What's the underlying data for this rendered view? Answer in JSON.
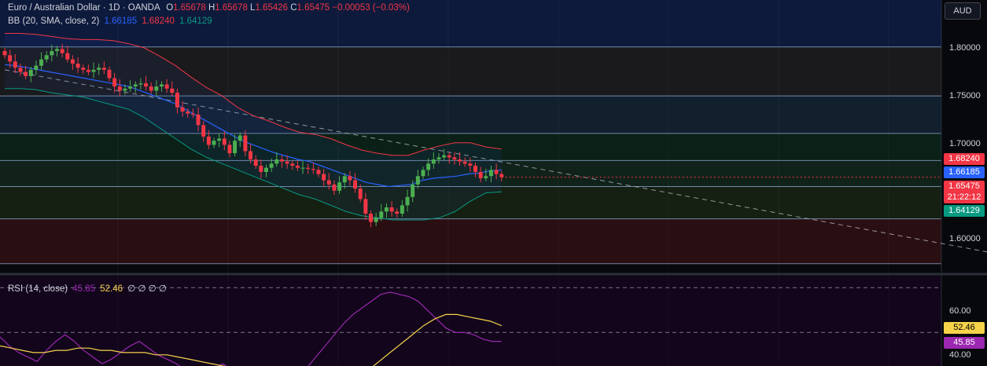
{
  "legend": {
    "symbol": "Euro / Australian Dollar · 1D · OANDA",
    "o_label": "O",
    "o_value": "1.65678",
    "h_label": "H",
    "h_value": "1.65678",
    "l_label": "L",
    "l_value": "1.65426",
    "c_label": "C",
    "c_value": "1.65475",
    "change": "−0.00053 (−0.03%)",
    "bb_label": "BB (20, SMA, close, 2)",
    "bb_basis": "1.66185",
    "bb_upper": "1.68240",
    "bb_lower": "1.64129",
    "rsi_label": "RSI (14, close)",
    "rsi_value": "45.85",
    "rsi_ma": "52.46",
    "rsi_extra": "∅ ∅ ∅ ∅"
  },
  "currency_button": "AUD",
  "price_axis": [
    "1.80000",
    "1.75000",
    "1.70000",
    "1.60000"
  ],
  "price_tags": {
    "upper": "1.68240",
    "basis": "1.66185",
    "close": "1.65475",
    "countdown": "21:22:12",
    "lower": "1.64129"
  },
  "rsi_axis": [
    "60.00",
    "40.00"
  ],
  "rsi_tags": {
    "ma": "52.46",
    "rsi": "45.85"
  },
  "colors": {
    "up": "#4caf50",
    "down": "#f23645",
    "upper_band": "#f23645",
    "basis": "#2962ff",
    "lower_band": "#089981",
    "rsi": "#9c27b0",
    "rsi_ma": "#f7d34a",
    "close_tag": "#f23645"
  },
  "chart_data": {
    "type": "candlestick",
    "title": "Euro / Australian Dollar · 1D · OANDA",
    "ylim": [
      1.565,
      1.825
    ],
    "horizontal_levels": [
      1.78,
      1.733,
      1.697,
      1.671,
      1.646,
      1.615,
      1.572
    ],
    "zones": [
      {
        "from": 1.78,
        "to": 1.825,
        "color": "#0e1a3c"
      },
      {
        "from": 1.733,
        "to": 1.78,
        "color": "#1a1a1d"
      },
      {
        "from": 1.697,
        "to": 1.733,
        "color": "#12202e"
      },
      {
        "from": 1.671,
        "to": 1.697,
        "color": "#0b2118"
      },
      {
        "from": 1.646,
        "to": 1.671,
        "color": "#10221a"
      },
      {
        "from": 1.615,
        "to": 1.646,
        "color": "#152012"
      },
      {
        "from": 1.572,
        "to": 1.615,
        "color": "#2a0f12"
      }
    ],
    "trendline": [
      [
        0,
        1.758
      ],
      [
        200,
        1.572
      ]
    ],
    "closes": [
      1.772,
      1.766,
      1.76,
      1.756,
      1.752,
      1.758,
      1.762,
      1.768,
      1.772,
      1.776,
      1.778,
      1.774,
      1.768,
      1.764,
      1.76,
      1.758,
      1.756,
      1.758,
      1.76,
      1.758,
      1.75,
      1.742,
      1.738,
      1.74,
      1.742,
      1.744,
      1.745,
      1.742,
      1.738,
      1.742,
      1.744,
      1.74,
      1.736,
      1.722,
      1.718,
      1.716,
      1.715,
      1.705,
      1.694,
      1.686,
      1.69,
      1.692,
      1.686,
      1.678,
      1.69,
      1.695,
      1.68,
      1.672,
      1.666,
      1.66,
      1.664,
      1.668,
      1.672,
      1.67,
      1.668,
      1.666,
      1.664,
      1.664,
      1.663,
      1.662,
      1.658,
      1.652,
      1.648,
      1.642,
      1.65,
      1.656,
      1.652,
      1.644,
      1.634,
      1.62,
      1.612,
      1.616,
      1.622,
      1.626,
      1.622,
      1.62,
      1.628,
      1.636,
      1.648,
      1.656,
      1.662,
      1.668,
      1.672,
      1.674,
      1.676,
      1.674,
      1.672,
      1.67,
      1.668,
      1.666,
      1.66,
      1.654,
      1.656,
      1.662,
      1.658,
      1.655
    ],
    "basis": [
      1.763,
      1.762,
      1.76,
      1.758,
      1.756,
      1.754,
      1.752,
      1.75,
      1.748,
      1.746,
      1.744,
      1.742,
      1.738,
      1.734,
      1.73,
      1.726,
      1.72,
      1.714,
      1.708,
      1.702,
      1.696,
      1.69,
      1.686,
      1.682,
      1.678,
      1.675,
      1.672,
      1.67,
      1.666,
      1.662,
      1.658,
      1.654,
      1.65,
      1.648,
      1.646,
      1.647,
      1.648,
      1.652,
      1.654,
      1.655,
      1.656,
      1.658,
      1.659,
      1.661,
      1.662
    ],
    "upper": [
      1.793,
      1.793,
      1.792,
      1.79,
      1.788,
      1.787,
      1.787,
      1.786,
      1.783,
      1.779,
      1.771,
      1.762,
      1.751,
      1.741,
      1.733,
      1.722,
      1.714,
      1.709,
      1.703,
      1.698,
      1.696,
      1.692,
      1.686,
      1.681,
      1.678,
      1.676,
      1.676,
      1.681,
      1.685,
      1.688,
      1.688,
      1.684,
      1.682
    ],
    "lower": [
      1.74,
      1.74,
      1.739,
      1.736,
      1.734,
      1.732,
      1.728,
      1.724,
      1.72,
      1.712,
      1.702,
      1.692,
      1.682,
      1.674,
      1.668,
      1.662,
      1.656,
      1.65,
      1.644,
      1.638,
      1.634,
      1.628,
      1.622,
      1.618,
      1.616,
      1.614,
      1.614,
      1.614,
      1.616,
      1.622,
      1.632,
      1.64,
      1.641
    ],
    "rsi_ylim": [
      35,
      75
    ],
    "rsi_levels": [
      70,
      50,
      30
    ],
    "rsi": [
      48,
      44,
      41,
      39,
      37,
      42,
      46,
      49,
      46,
      42,
      39,
      36,
      38,
      41,
      44,
      46,
      43,
      40,
      38,
      36,
      33,
      31,
      32,
      34,
      36,
      33,
      31,
      30,
      29,
      30,
      31,
      30,
      29,
      34,
      39,
      44,
      49,
      54,
      58,
      61,
      64,
      67,
      68,
      67,
      66,
      64,
      60,
      56,
      52,
      50,
      50,
      49,
      47,
      46,
      46
    ],
    "rsi_ma": [
      44,
      43,
      42,
      41,
      41,
      42,
      42,
      43,
      43,
      42,
      42,
      41,
      41,
      41,
      40,
      40,
      39,
      38,
      37,
      36,
      35,
      34,
      34,
      34,
      33,
      32,
      31,
      31,
      31,
      31,
      31,
      31,
      31,
      33,
      37,
      41,
      45,
      49,
      53,
      56,
      58,
      58,
      57,
      56,
      55,
      53
    ]
  }
}
